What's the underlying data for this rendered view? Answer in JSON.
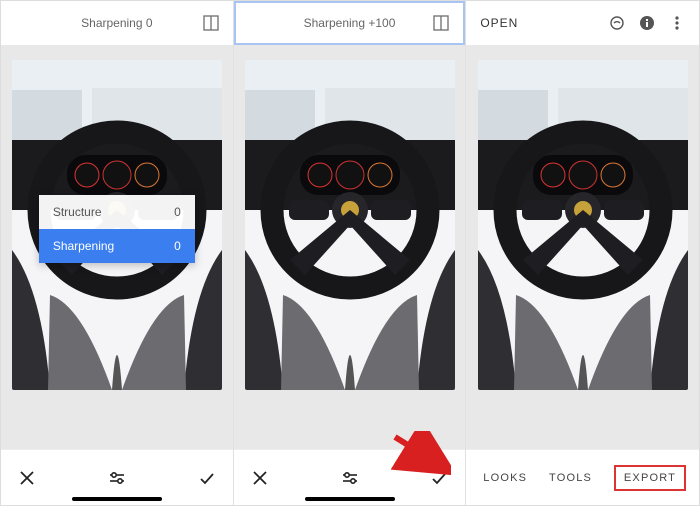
{
  "panel1": {
    "title": "Sharpening 0",
    "options": {
      "structure": {
        "label": "Structure",
        "value": "0"
      },
      "sharpening": {
        "label": "Sharpening",
        "value": "0"
      }
    }
  },
  "panel2": {
    "title": "Sharpening +100"
  },
  "panel3": {
    "open": "OPEN",
    "bottom": {
      "looks": "LOOKS",
      "tools": "TOOLS",
      "export": "EXPORT"
    }
  },
  "icons": {
    "pages": "pages-icon",
    "cancel": "close-icon",
    "adjust": "adjust-icon",
    "confirm": "check-icon",
    "layers": "layers-icon",
    "info": "info-icon",
    "more": "more-icon"
  }
}
